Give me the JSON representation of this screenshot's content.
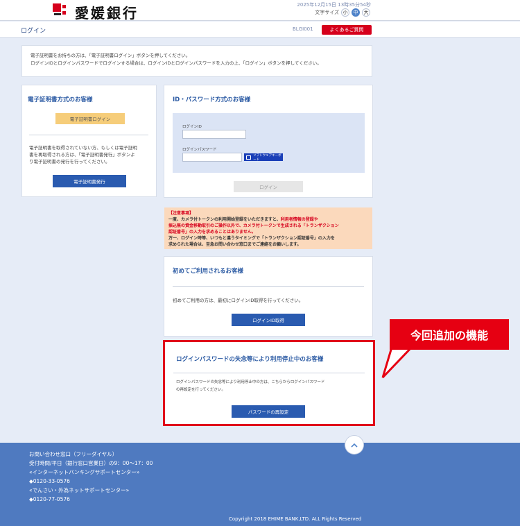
{
  "header": {
    "bank_name": "愛媛銀行",
    "datetime": "2025年12月15日 13時35分54秒",
    "font_size_label": "文字サイズ",
    "font_sizes": [
      "小",
      "中",
      "大"
    ],
    "active_font_size": "中"
  },
  "title_bar": {
    "page_title": "ログイン",
    "screen_id": "BLGI001",
    "faq_label": "よくあるご質問"
  },
  "notice": {
    "line1": "電子証明書をお持ちの方は、「電子証明書ログイン」ボタンを押してください。",
    "line2": "ログインIDとログインパスワードでログインする場合は、ログインIDとログインパスワードを入力の上、「ログイン」ボタンを押してください。"
  },
  "cert_panel": {
    "heading": "電子証明書方式のお客様",
    "login_button": "電子証明書ログイン",
    "desc_line1": "電子証明書を取得されていない方、もしくは電子証明",
    "desc_line2": "書を再取得される方は、「電子証明書発行」ボタンよ",
    "desc_line3": "り電子証明書の発行を行ってください。",
    "issue_button": "電子証明書発行"
  },
  "id_panel": {
    "heading": "ID・パスワード方式のお客様",
    "login_id_label": "ログインID",
    "password_label": "ログインパスワード",
    "software_keyboard": "ソフトウェアキーボード",
    "login_button": "ログイン"
  },
  "warning": {
    "title": "【注意事項】",
    "line1a": "一度、カメラ付トークンの利用開始登録をいただきますと、",
    "line1b": "利用者情報の登録や",
    "line2": "振込無の資金移動取引のご操作以外で、カメラ付トークンで生成される「トランザクション",
    "line3": "認証番号」の入力を求めることはありません。",
    "line4": "万一、ログイン時等、いつもと違うタイミングで「トランザクション認証番号」の入力を",
    "line5": "求められた場合は、至急お問い合わせ窓口までご連絡をお願いします。"
  },
  "first_time_panel": {
    "heading": "初めてご利用されるお客様",
    "desc": "初めてご利用の方は、最初にログインID取得を行ってください。",
    "button": "ログインID取得"
  },
  "suspended_panel": {
    "heading": "ログインパスワードの失念等により利用停止中のお客様",
    "desc_line1": "ログインパスワードの失念等により利用停止中の方は、こちらからログインパスワード",
    "desc_line2": "の再設定を行ってください。",
    "button": "パスワードの再設定"
  },
  "callout": {
    "label": "今回追加の機能"
  },
  "footer": {
    "lines": [
      "お問い合わせ窓口（フリーダイヤル）",
      "受付時間/平日（銀行窓口営業日）の9：00～17：00",
      "«インターネットバンキングサポートセンター»",
      "◆0120-33-0576",
      "«でんさい・外為ネットサポートセンター»",
      "◆0120-77-0576"
    ],
    "copyright": "Copyright 2018 EHIME BANK,LTD. ALL Rights Reserved"
  },
  "colors": {
    "brand_red": "#d6001c",
    "primary_blue": "#2a5bb0",
    "footer_blue": "#4f7ac0",
    "background": "#e6ecf7"
  }
}
